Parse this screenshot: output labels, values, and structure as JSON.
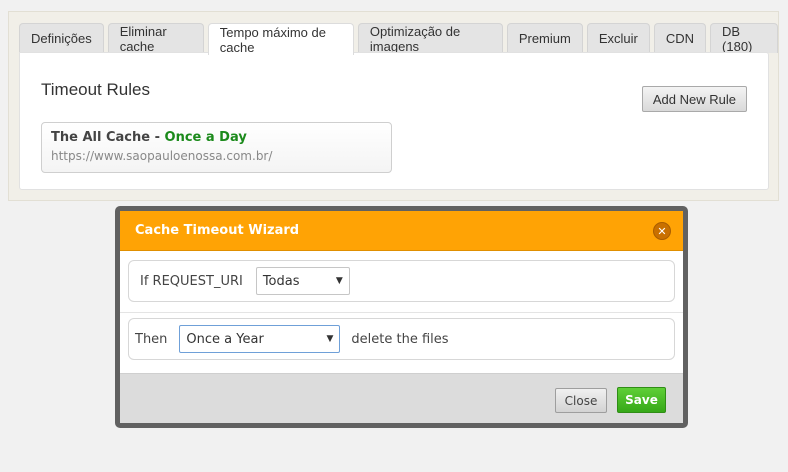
{
  "tabs": [
    {
      "label": "Definições"
    },
    {
      "label": "Eliminar cache"
    },
    {
      "label": "Tempo máximo de cache",
      "active": true
    },
    {
      "label": "Optimização de imagens"
    },
    {
      "label": "Premium"
    },
    {
      "label": "Excluir"
    },
    {
      "label": "CDN"
    },
    {
      "label": "DB (180)"
    }
  ],
  "settings": {
    "section_title": "Timeout Rules",
    "add_rule_label": "Add New Rule",
    "rule": {
      "name": "The All Cache",
      "separator": " - ",
      "timeout": "Once a Day",
      "url": "https://www.saopauloenossa.com.br/"
    }
  },
  "wizard": {
    "title": "Cache Timeout Wizard",
    "close_icon": "close-icon",
    "condition_label": "If REQUEST_URI",
    "condition_value": "Todas",
    "then_label": "Then",
    "timeout_value": "Once a Year",
    "action_label": "delete the files",
    "close_label": "Close",
    "save_label": "Save"
  },
  "colors": {
    "accent": "#ffa305",
    "rule_timeout": "#1b8a1b",
    "save_button": "#3fb51f"
  }
}
